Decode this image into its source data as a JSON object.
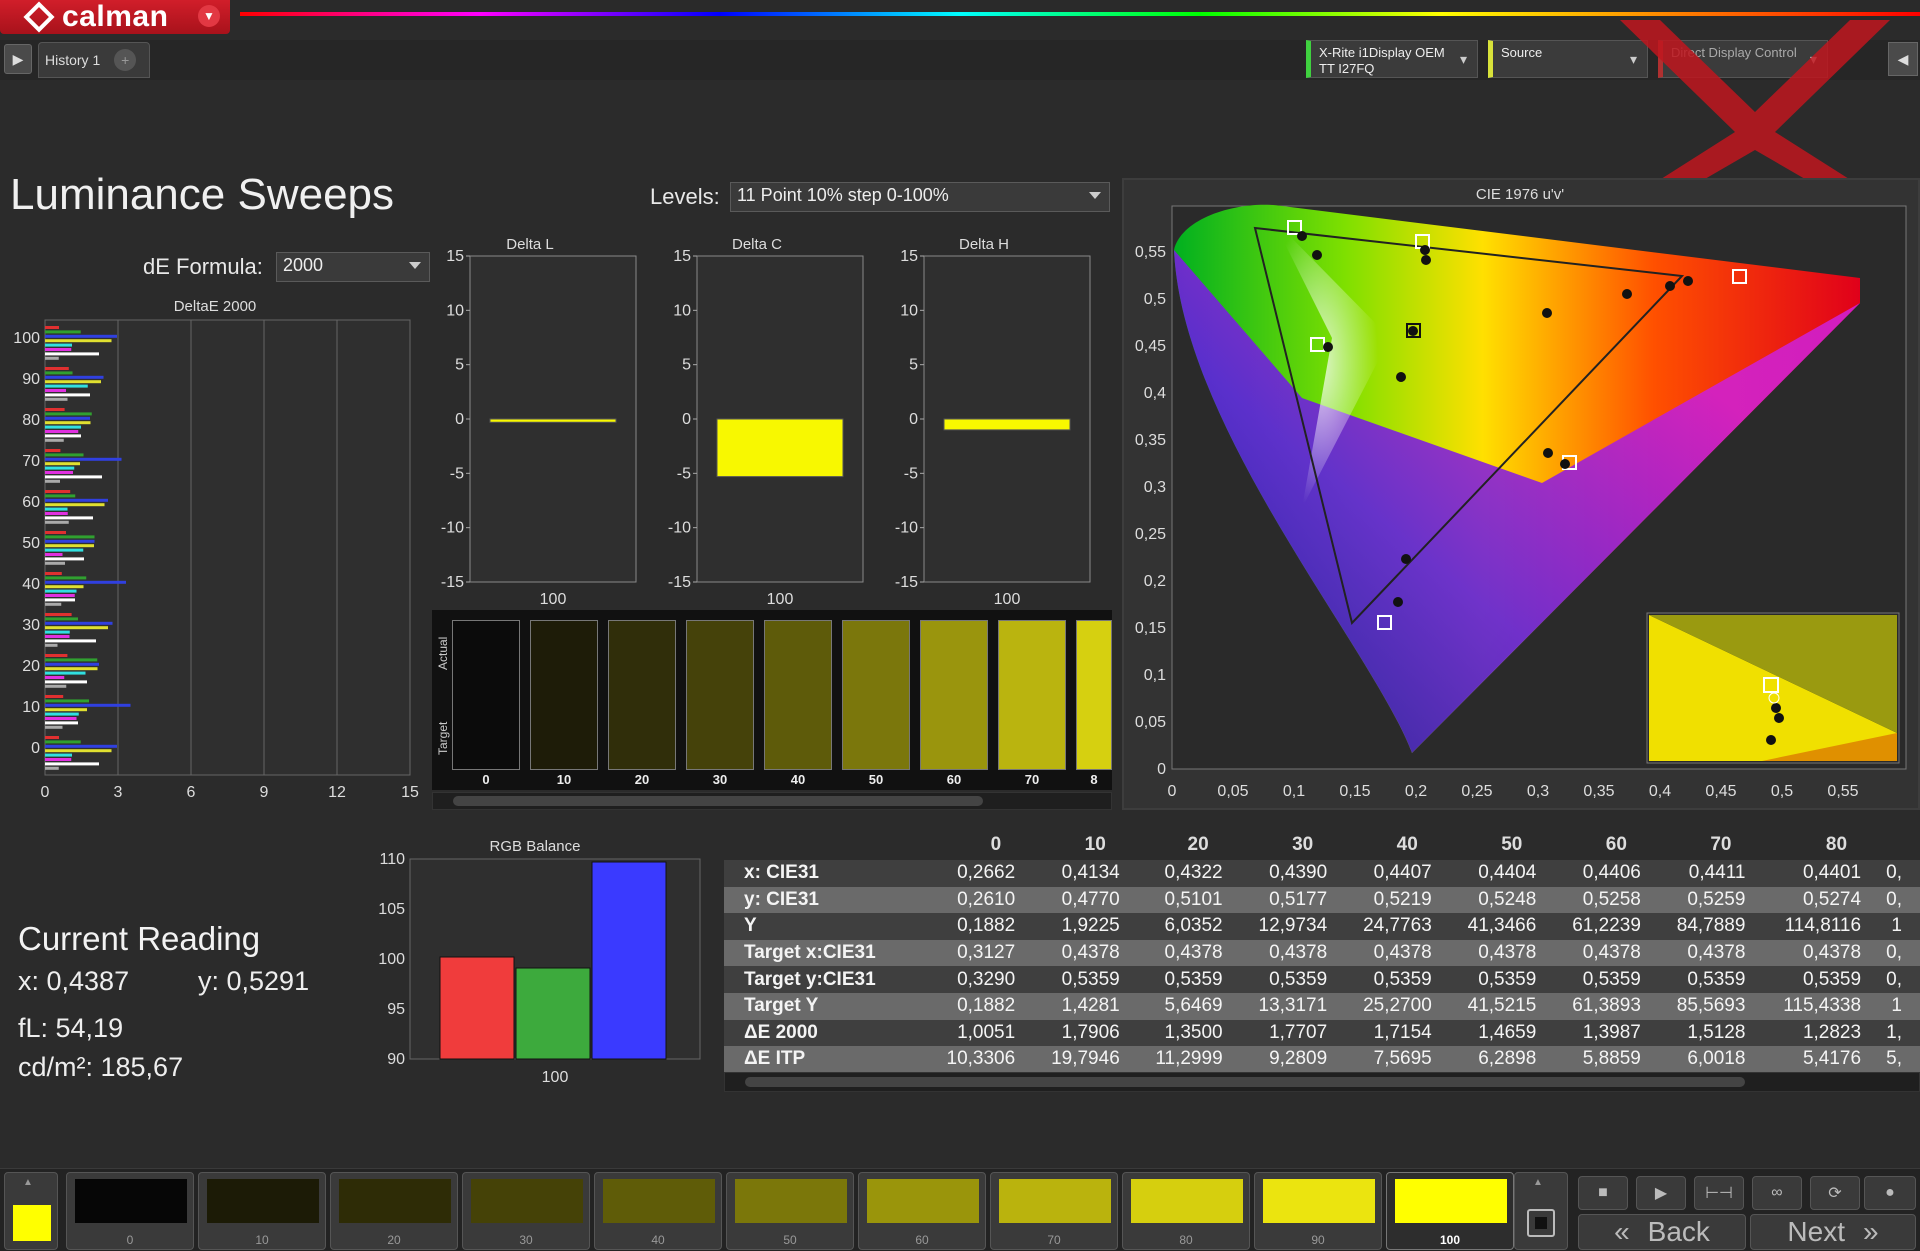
{
  "app": {
    "brand": "calman",
    "tab_label": "History 1",
    "devices": [
      {
        "line1": "X-Rite i1Display OEM",
        "line2": "TT I27FQ"
      },
      {
        "line1": "Source",
        "line2": ""
      },
      {
        "line1": "Direct Display Control",
        "line2": ""
      }
    ]
  },
  "page": {
    "title": "Luminance Sweeps",
    "de_formula_label": "dE Formula:",
    "de_formula_value": "2000",
    "levels_label": "Levels:",
    "levels_value": "11 Point 10% step 0-100%"
  },
  "deltae_chart": {
    "title": "DeltaE 2000",
    "y_ticks": [
      "100",
      "90",
      "80",
      "70",
      "60",
      "50",
      "40",
      "30",
      "20",
      "10",
      "0"
    ],
    "x_ticks": [
      "0",
      "3",
      "6",
      "9",
      "12",
      "15"
    ]
  },
  "delta_charts": [
    {
      "title": "Delta L",
      "value": -0.3,
      "xlabel": "100"
    },
    {
      "title": "Delta C",
      "value": -5.3,
      "xlabel": "100"
    },
    {
      "title": "Delta H",
      "value": -1.0,
      "xlabel": "100"
    }
  ],
  "delta_y_ticks": [
    "15",
    "10",
    "5",
    "0",
    "-5",
    "-10",
    "-15"
  ],
  "swatch_panel": {
    "actual_label": "Actual",
    "target_label": "Target",
    "items": [
      {
        "label": "0",
        "color": "#0b0b0b"
      },
      {
        "label": "10",
        "color": "#1e1c08"
      },
      {
        "label": "20",
        "color": "#302e0a"
      },
      {
        "label": "30",
        "color": "#45420a"
      },
      {
        "label": "40",
        "color": "#5e5b0a"
      },
      {
        "label": "50",
        "color": "#7b770c"
      },
      {
        "label": "60",
        "color": "#9a950d"
      },
      {
        "label": "70",
        "color": "#bab40f"
      },
      {
        "label": "8",
        "color": "#d6d010"
      }
    ]
  },
  "cie": {
    "title": "CIE 1976 u'v'",
    "y_ticks": [
      "0",
      "0,05",
      "0,1",
      "0,15",
      "0,2",
      "0,25",
      "0,3",
      "0,35",
      "0,4",
      "0,45",
      "0,5",
      "0,55"
    ],
    "x_ticks": [
      "0",
      "0,05",
      "0,1",
      "0,15",
      "0,2",
      "0,25",
      "0,3",
      "0,35",
      "0,4",
      "0,45",
      "0,5",
      "0,55"
    ]
  },
  "rgb_balance": {
    "title": "RGB Balance",
    "y_ticks": [
      "110",
      "105",
      "100",
      "95",
      "90"
    ],
    "x_label": "100",
    "values": {
      "red": 100.2,
      "green": 99.1,
      "blue": 109.7
    },
    "colors": {
      "red": "#f03c3c",
      "green": "#3daa3d",
      "blue": "#3a3aff"
    }
  },
  "current_reading": {
    "title": "Current Reading",
    "x": "x: 0,4387",
    "y": "y: 0,5291",
    "fl": "fL: 54,19",
    "cdm2": "cd/m²: 185,67"
  },
  "table": {
    "columns": [
      "0",
      "10",
      "20",
      "30",
      "40",
      "50",
      "60",
      "70",
      "80"
    ],
    "rows": [
      {
        "label": "x: CIE31",
        "values": [
          "0,2662",
          "0,4134",
          "0,4322",
          "0,4390",
          "0,4407",
          "0,4404",
          "0,4406",
          "0,4411",
          "0,4401",
          "0,"
        ]
      },
      {
        "label": "y: CIE31",
        "values": [
          "0,2610",
          "0,4770",
          "0,5101",
          "0,5177",
          "0,5219",
          "0,5248",
          "0,5258",
          "0,5259",
          "0,5274",
          "0,"
        ]
      },
      {
        "label": "Y",
        "values": [
          "0,1882",
          "1,9225",
          "6,0352",
          "12,9734",
          "24,7763",
          "41,3466",
          "61,2239",
          "84,7889",
          "114,8116",
          "1"
        ]
      },
      {
        "label": "Target x:CIE31",
        "values": [
          "0,3127",
          "0,4378",
          "0,4378",
          "0,4378",
          "0,4378",
          "0,4378",
          "0,4378",
          "0,4378",
          "0,4378",
          "0,"
        ]
      },
      {
        "label": "Target y:CIE31",
        "values": [
          "0,3290",
          "0,5359",
          "0,5359",
          "0,5359",
          "0,5359",
          "0,5359",
          "0,5359",
          "0,5359",
          "0,5359",
          "0,"
        ]
      },
      {
        "label": "Target Y",
        "values": [
          "0,1882",
          "1,4281",
          "5,6469",
          "13,3171",
          "25,2700",
          "41,5215",
          "61,3893",
          "85,5693",
          "115,4338",
          "1"
        ]
      },
      {
        "label": "ΔE 2000",
        "values": [
          "1,0051",
          "1,7906",
          "1,3500",
          "1,7707",
          "1,7154",
          "1,4659",
          "1,3987",
          "1,5128",
          "1,2823",
          "1,"
        ]
      },
      {
        "label": "ΔE ITP",
        "values": [
          "10,3306",
          "19,7946",
          "11,2999",
          "9,2809",
          "7,5695",
          "6,2898",
          "5,8859",
          "6,0018",
          "5,4176",
          "5,"
        ]
      }
    ]
  },
  "bottom": {
    "patches": [
      {
        "label": "0",
        "color": "#060606"
      },
      {
        "label": "10",
        "color": "#1c1b06"
      },
      {
        "label": "20",
        "color": "#2e2c06"
      },
      {
        "label": "30",
        "color": "#454207"
      },
      {
        "label": "40",
        "color": "#5f5c08"
      },
      {
        "label": "50",
        "color": "#7b770a"
      },
      {
        "label": "60",
        "color": "#9a950b"
      },
      {
        "label": "70",
        "color": "#bab30d"
      },
      {
        "label": "80",
        "color": "#d6cf0e"
      },
      {
        "label": "90",
        "color": "#ebe40f"
      },
      {
        "label": "100",
        "color": "#ffff00"
      }
    ],
    "back_label": "Back",
    "next_label": "Next",
    "current_swatch_color": "#ffff00"
  }
}
